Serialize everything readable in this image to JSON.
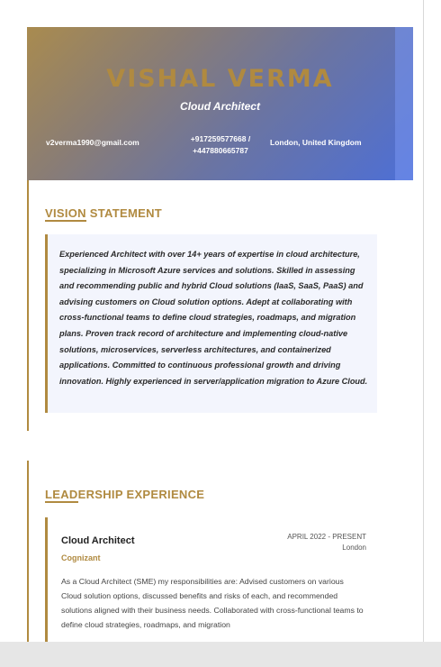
{
  "header": {
    "name": "VISHAL VERMA",
    "title": "Cloud Architect",
    "email": "v2verma1990@gmail.com",
    "phone_line1": "+917259577668 /",
    "phone_line2": "+447880665787",
    "location": "London, United Kingdom"
  },
  "vision": {
    "heading_underlined": "VISION",
    "heading_rest": " STATEMENT",
    "text": "Experienced Architect with over 14+ years of expertise in cloud architecture, specializing in Microsoft Azure services and solutions. Skilled in assessing and recommending public and hybrid Cloud solutions (IaaS, SaaS, PaaS) and advising customers on Cloud solution options. Adept at collaborating with cross-functional teams to define cloud strategies, roadmaps, and migration plans. Proven track record of architecture and implementing cloud-native solutions, microservices, serverless architectures, and containerized applications. Committed to continuous professional growth and driving innovation. Highly experienced in server/application migration to Azure Cloud."
  },
  "leadership": {
    "heading_underlined": "LEAD",
    "heading_rest": "ERSHIP EXPERIENCE",
    "jobs": [
      {
        "title": "Cloud Architect",
        "company": "Cognizant",
        "date": "APRIL 2022 - PRESENT",
        "location": "London",
        "description": "As a Cloud Architect (SME) my responsibilities are: Advised customers on various Cloud solution options, discussed benefits and risks of each, and recommended solutions aligned with their business needs. Collaborated with cross-functional teams to define cloud strategies, roadmaps, and migration"
      }
    ]
  },
  "colors": {
    "accent": "#b08a40",
    "header_gradient_start": "#a98b4f",
    "header_gradient_end": "#4d6fd6",
    "quote_background": "#f3f5fd"
  }
}
